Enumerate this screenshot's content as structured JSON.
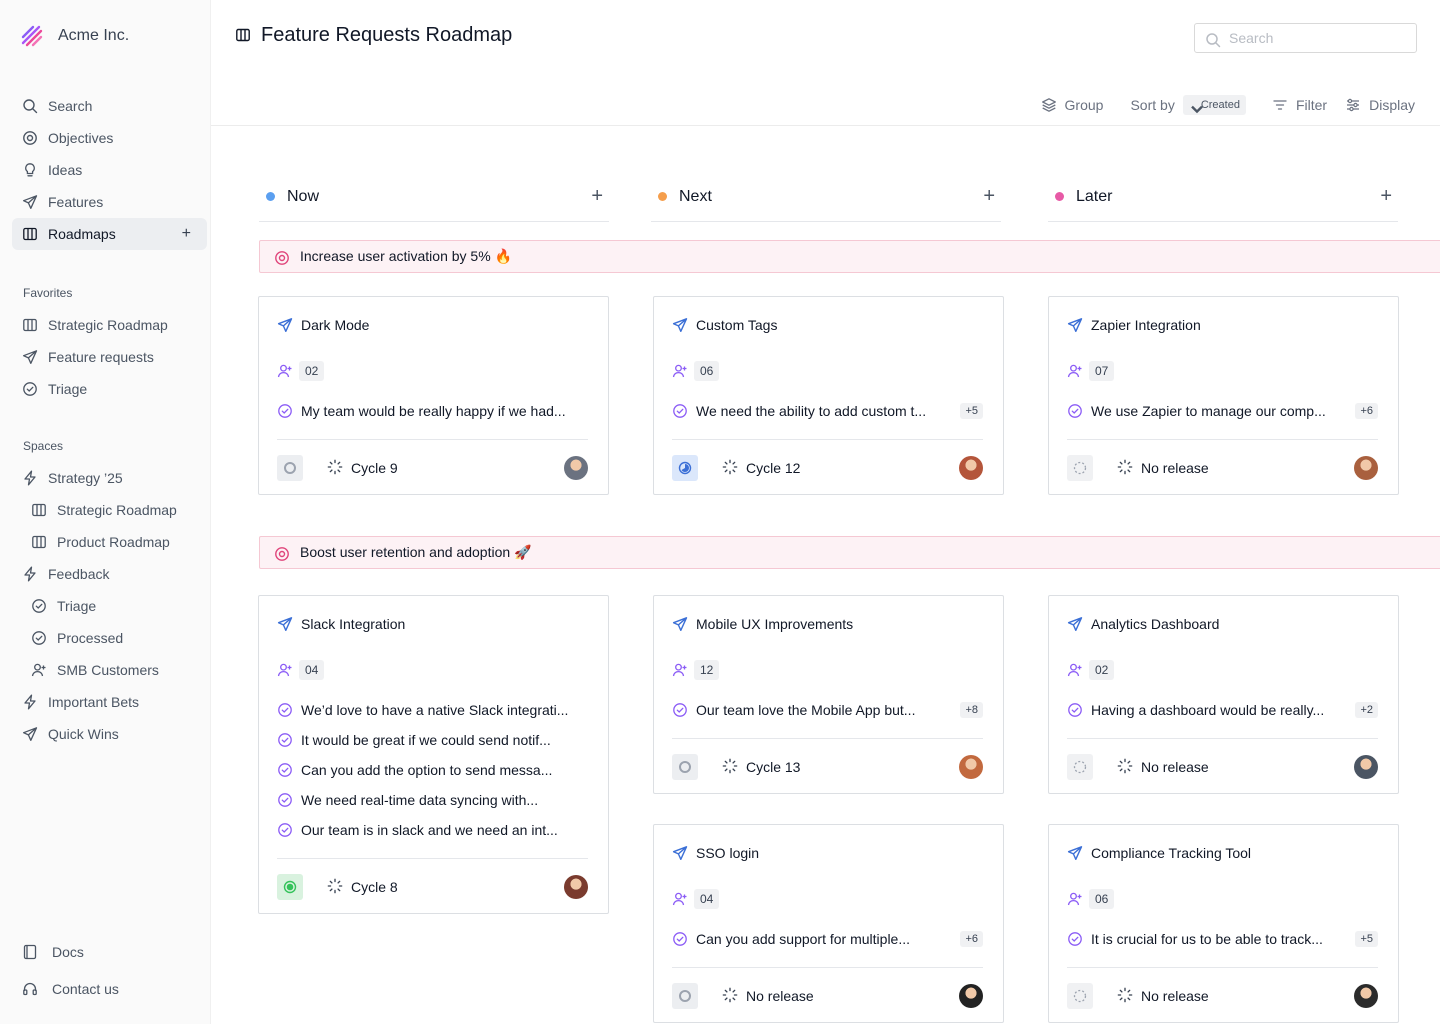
{
  "brand": {
    "name": "Acme Inc."
  },
  "sidebar": {
    "nav": [
      {
        "label": "Search",
        "icon": "search-icon"
      },
      {
        "label": "Objectives",
        "icon": "target-icon"
      },
      {
        "label": "Ideas",
        "icon": "lightbulb-icon"
      },
      {
        "label": "Features",
        "icon": "paper-plane-icon"
      },
      {
        "label": "Roadmaps",
        "icon": "map-icon",
        "active": true,
        "action": "+"
      }
    ],
    "favorites_label": "Favorites",
    "favorites": [
      {
        "label": "Strategic Roadmap",
        "icon": "map-icon"
      },
      {
        "label": "Feature requests",
        "icon": "paper-plane-icon"
      },
      {
        "label": "Triage",
        "icon": "check-circle-icon"
      }
    ],
    "spaces_label": "Spaces",
    "spaces": [
      {
        "label": "Strategy ’25",
        "icon": "bolt-icon"
      },
      {
        "label": "Strategic Roadmap",
        "icon": "map-icon",
        "sub": true
      },
      {
        "label": "Product Roadmap",
        "icon": "map-icon",
        "sub": true
      },
      {
        "label": "Feedback",
        "icon": "bolt-icon"
      },
      {
        "label": "Triage",
        "icon": "check-circle-icon",
        "sub": true
      },
      {
        "label": "Processed",
        "icon": "check-circle-icon",
        "sub": true
      },
      {
        "label": "SMB Customers",
        "icon": "user-plus-icon",
        "sub": true
      },
      {
        "label": "Important Bets",
        "icon": "bolt-icon"
      },
      {
        "label": "Quick Wins",
        "icon": "paper-plane-icon"
      }
    ],
    "bottom": [
      {
        "label": "Docs",
        "icon": "book-icon"
      },
      {
        "label": "Contact us",
        "icon": "headset-icon"
      }
    ]
  },
  "header": {
    "title": "Feature Requests Roadmap",
    "search_placeholder": "Search",
    "toolbar": {
      "group": "Group",
      "sort_by": "Sort by",
      "sort_value": "Created",
      "filter": "Filter",
      "display": "Display"
    }
  },
  "columns": [
    {
      "label": "Now",
      "color": "#5b9ff0",
      "add": "+"
    },
    {
      "label": "Next",
      "color": "#f59e4c",
      "add": "+"
    },
    {
      "label": "Later",
      "color": "#e75aa6",
      "add": "+"
    }
  ],
  "objectives": [
    {
      "label": "Increase user activation by 5% 🔥"
    },
    {
      "label": "Boost user retention and adoption 🚀"
    }
  ],
  "cards": [
    {
      "title": "Dark Mode",
      "count": "02",
      "requests": [
        "My team would be really happy if we had..."
      ],
      "more": "",
      "status": "gray",
      "cycle": "Cycle 9",
      "avatar": "#6b7280"
    },
    {
      "title": "Custom Tags",
      "count": "06",
      "requests": [
        "We need the ability to add custom t..."
      ],
      "more": "+5",
      "status": "blue",
      "cycle": "Cycle 12",
      "avatar": "#b4553a"
    },
    {
      "title": "Zapier Integration",
      "count": "07",
      "requests": [
        "We use Zapier to manage our comp..."
      ],
      "more": "+6",
      "status": "dashed",
      "cycle": "No release",
      "avatar": "#a9603e"
    },
    {
      "title": "Slack Integration",
      "count": "04",
      "requests": [
        "We’d love to have a native Slack integrati...",
        "It would be great if we could send notif...",
        "Can you add the option to send messa...",
        "We need real-time data syncing with...",
        "Our team is in slack and we need an int..."
      ],
      "more": "",
      "status": "green",
      "cycle": "Cycle 8",
      "avatar": "#7a3b2e"
    },
    {
      "title": "Mobile UX Improvements",
      "count": "12",
      "requests": [
        "Our team love the Mobile App but..."
      ],
      "more": "+8",
      "status": "gray",
      "cycle": "Cycle 13",
      "avatar": "#c2693e"
    },
    {
      "title": "Analytics Dashboard",
      "count": "02",
      "requests": [
        "Having a dashboard would be really..."
      ],
      "more": "+2",
      "status": "dashed",
      "cycle": "No release",
      "avatar": "#4b5563"
    },
    {
      "title": "SSO login",
      "count": "04",
      "requests": [
        "Can you add support for multiple..."
      ],
      "more": "+6",
      "status": "gray",
      "cycle": "No release",
      "avatar": "#222222"
    },
    {
      "title": "Compliance Tracking Tool",
      "count": "06",
      "requests": [
        "It is crucial for us to be able to track..."
      ],
      "more": "+5",
      "status": "dashed",
      "cycle": "No release",
      "avatar": "#2b2b2b"
    }
  ]
}
